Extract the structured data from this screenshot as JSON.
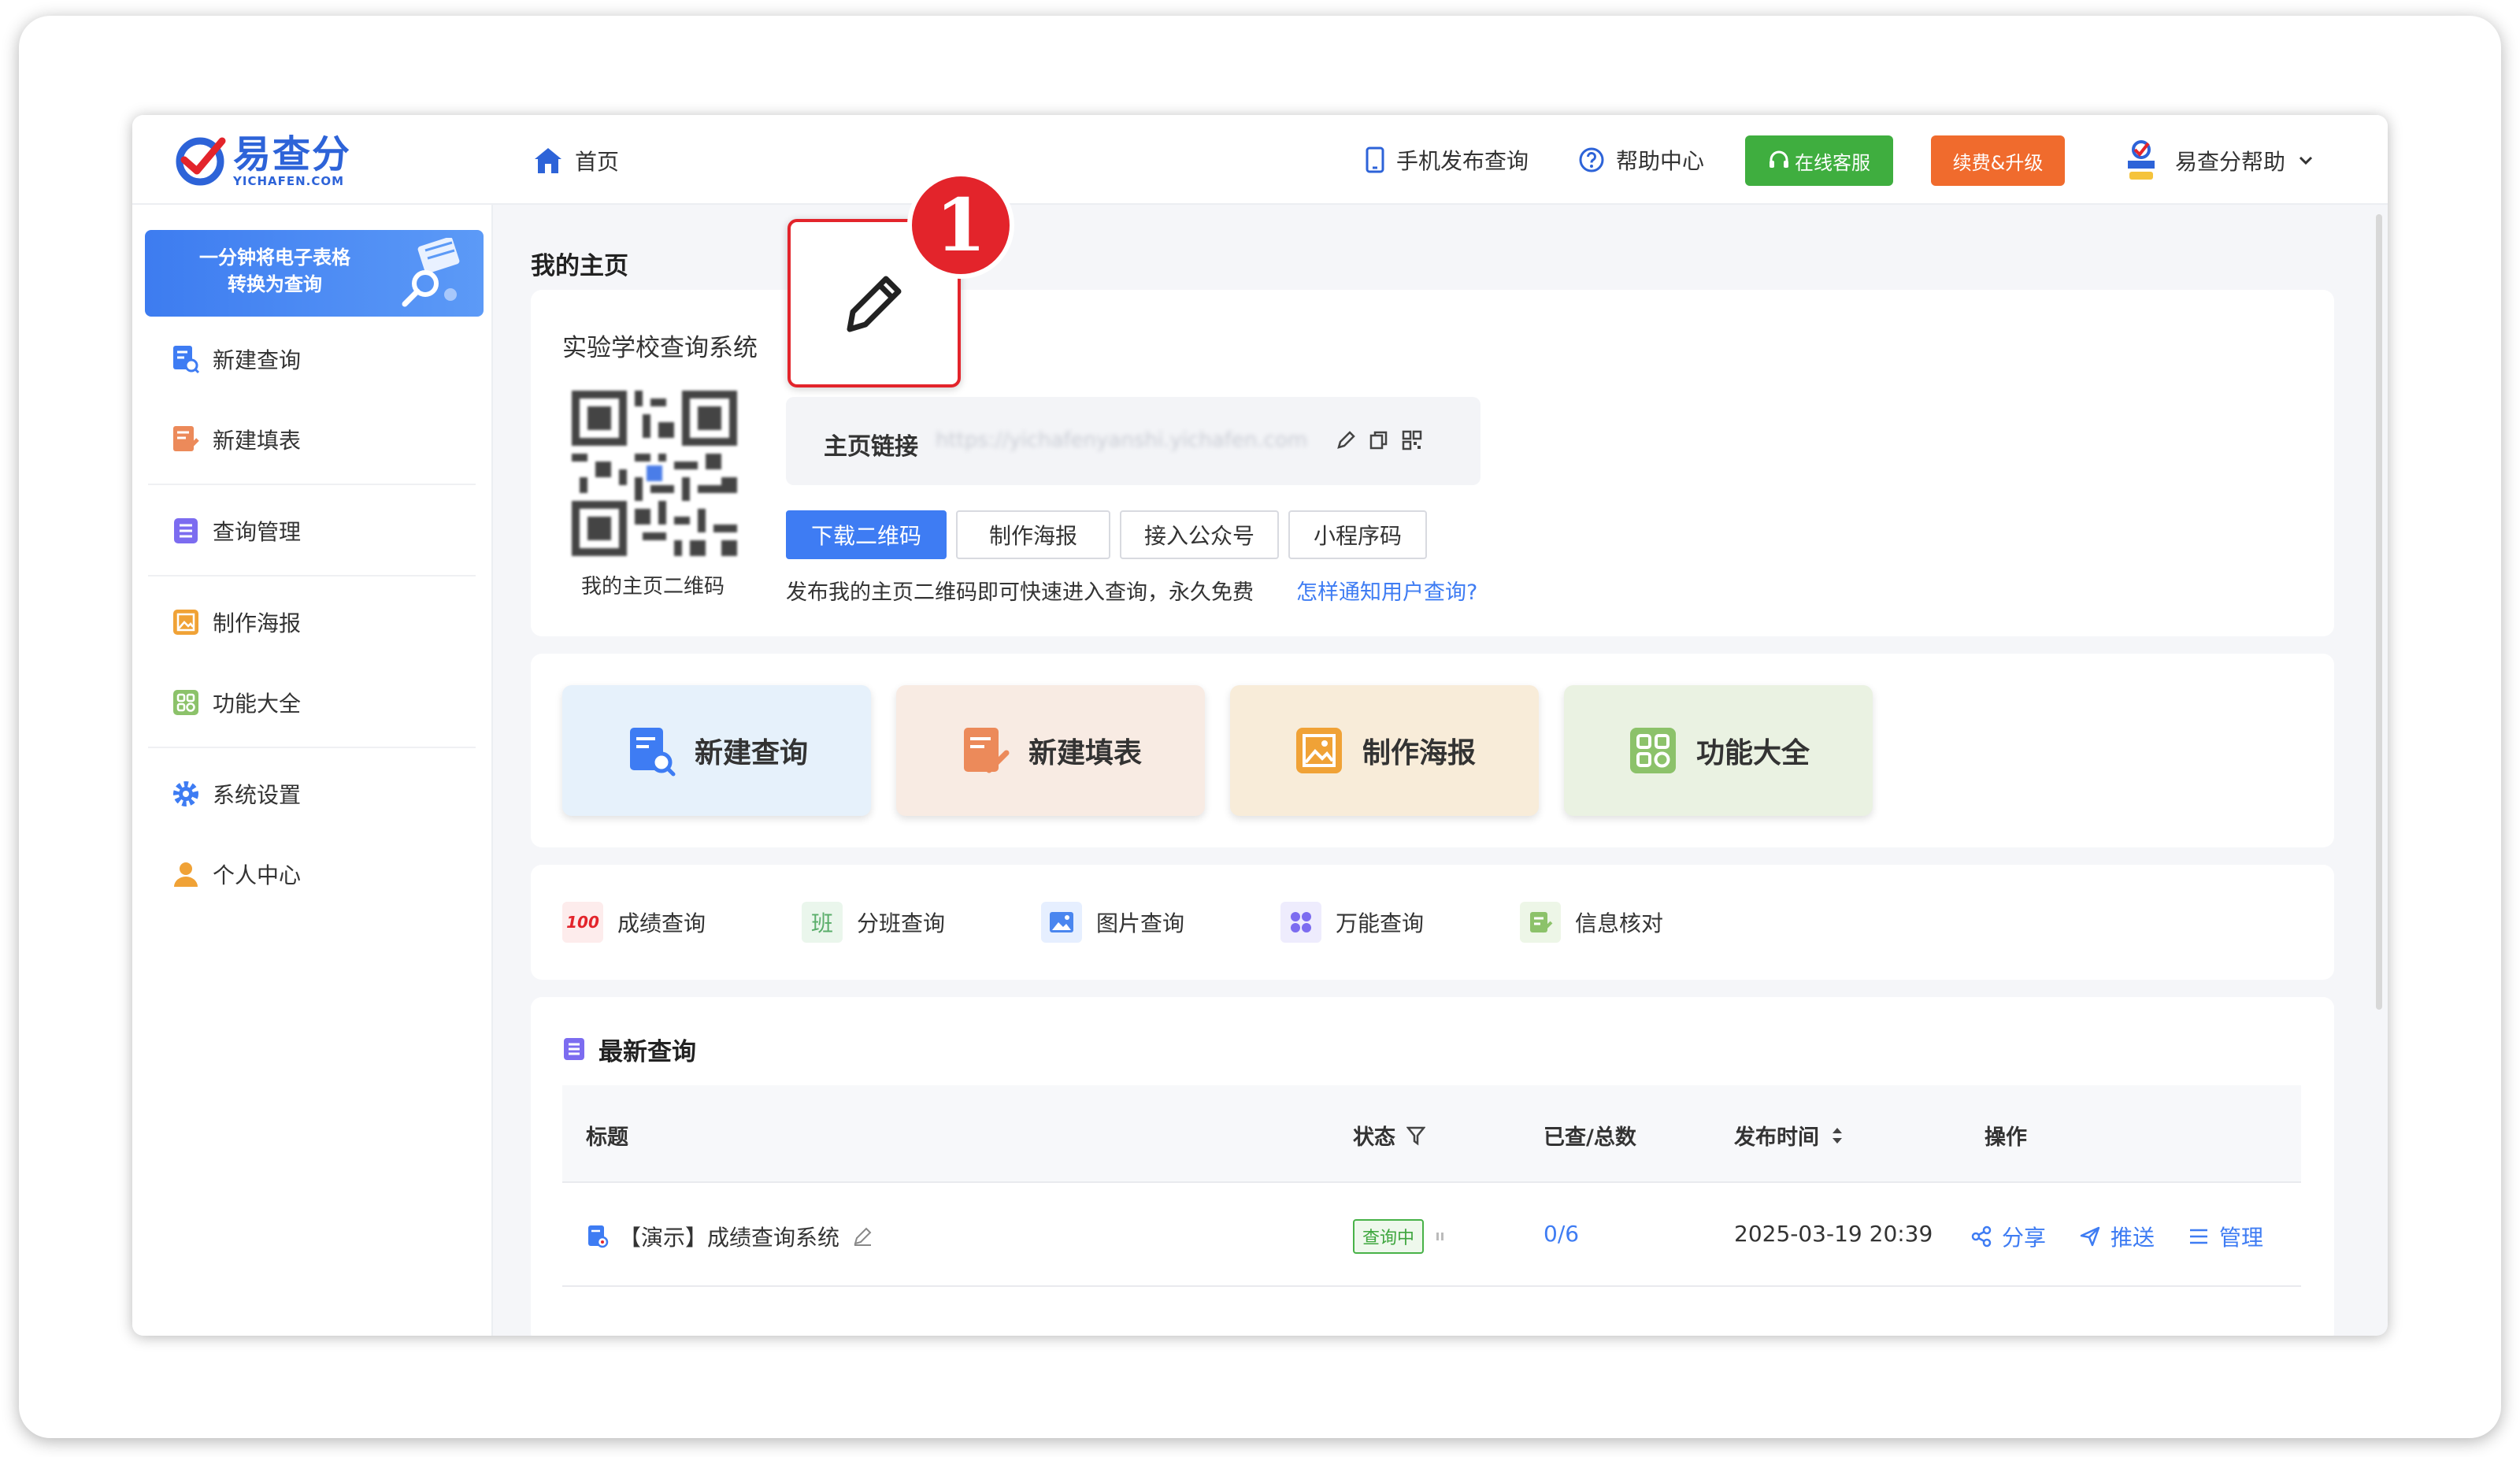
{
  "header": {
    "logo_text": "易查分",
    "logo_sub": "YICHAFEN.COM",
    "home": "首页",
    "mobile_publish": "手机发布查询",
    "help_center": "帮助中心",
    "online_service": "在线客服",
    "upgrade": "续费&升级",
    "user_name": "易查分帮助"
  },
  "sidebar": {
    "promo": [
      "一分钟将电子表格",
      "转换为查询"
    ],
    "items": [
      {
        "label": "新建查询",
        "icon": "new-query-icon"
      },
      {
        "label": "新建填表",
        "icon": "new-form-icon"
      },
      {
        "label": "查询管理",
        "icon": "query-manage-icon"
      },
      {
        "label": "制作海报",
        "icon": "poster-icon"
      },
      {
        "label": "功能大全",
        "icon": "features-icon"
      },
      {
        "label": "系统设置",
        "icon": "settings-icon"
      },
      {
        "label": "个人中心",
        "icon": "user-icon"
      }
    ]
  },
  "main": {
    "page_title": "我的主页",
    "site_name": "实验学校查询系统",
    "qr_caption": "我的主页二维码",
    "link_label": "主页链接",
    "link_url": "https://yichafenyanshi.yichafen.com",
    "buttons": [
      "下载二维码",
      "制作海报",
      "接入公众号",
      "小程序码"
    ],
    "tip": "发布我的主页二维码即可快速进入查询，永久免费",
    "tip_link": "怎样通知用户查询?",
    "tiles": [
      {
        "label": "新建查询",
        "bg": "#e6f1fb"
      },
      {
        "label": "新建填表",
        "bg": "#f8ebe3"
      },
      {
        "label": "制作海报",
        "bg": "#f8ecd9"
      },
      {
        "label": "功能大全",
        "bg": "#eaf2e2"
      }
    ],
    "chips": [
      "成绩查询",
      "分班查询",
      "图片查询",
      "万能查询",
      "信息核对"
    ],
    "chip_ban_glyph": "班",
    "chip_100_glyph": "100",
    "latest_title": "最新查询",
    "table": {
      "headers": [
        "标题",
        "状态",
        "已查/总数",
        "发布时间",
        "操作"
      ],
      "rows": [
        {
          "title": "【演示】成绩查询系统",
          "status": "查询中",
          "count": "0/6",
          "time": "2025-03-19 20:39",
          "actions": [
            "分享",
            "推送",
            "管理"
          ]
        }
      ]
    }
  },
  "callout": {
    "number": "1"
  }
}
